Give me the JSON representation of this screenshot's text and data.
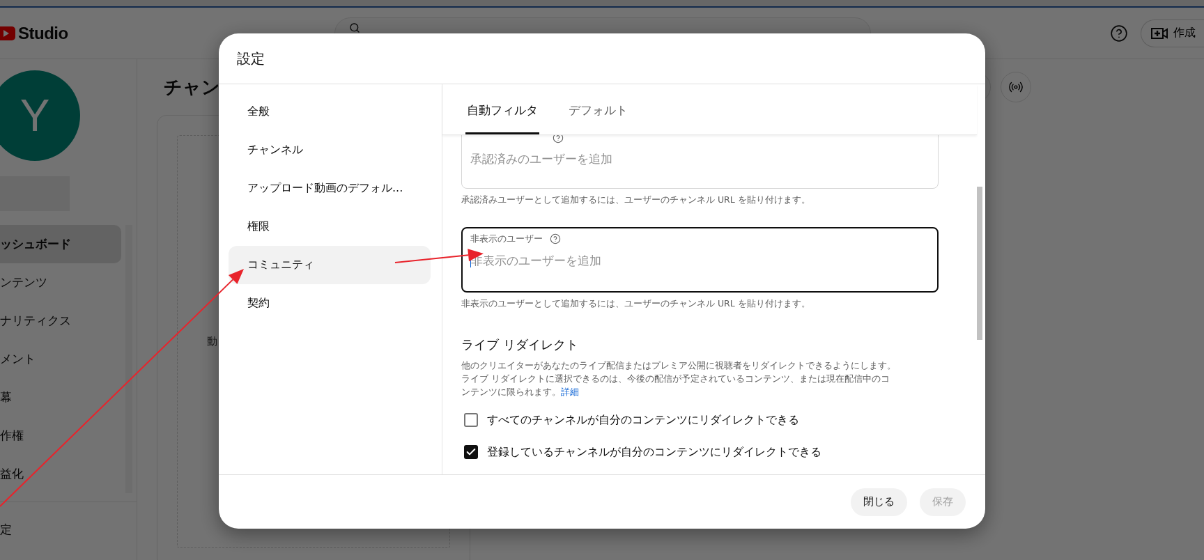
{
  "app": {
    "logo_text": "Studio",
    "create_label": "作成"
  },
  "sidebar": {
    "avatar_letter": "Y",
    "items": [
      {
        "label": "ッシュボード",
        "selected": true
      },
      {
        "label": "ンテンツ",
        "selected": false
      },
      {
        "label": "ナリティクス",
        "selected": false
      },
      {
        "label": "メント",
        "selected": false
      },
      {
        "label": "幕",
        "selected": false
      },
      {
        "label": "作権",
        "selected": false
      },
      {
        "label": "益化",
        "selected": false
      }
    ],
    "settings_label": "定"
  },
  "main": {
    "title": "チャン",
    "card_text": "動"
  },
  "dialog": {
    "title": "設定",
    "nav": [
      {
        "label": "全般",
        "selected": false
      },
      {
        "label": "チャンネル",
        "selected": false
      },
      {
        "label": "アップロード動画のデフォル...",
        "selected": false
      },
      {
        "label": "権限",
        "selected": false
      },
      {
        "label": "コミュニティ",
        "selected": true
      },
      {
        "label": "契約",
        "selected": false
      }
    ],
    "tabs": [
      {
        "label": "自動フィルタ",
        "selected": true
      },
      {
        "label": "デフォルト",
        "selected": false
      }
    ],
    "fields": [
      {
        "placeholder": "承認済みのユーザーを追加",
        "focused": false,
        "helper": "承認済みユーザーとして追加するには、ユーザーのチャンネル URL を貼り付けます。"
      },
      {
        "label": "非表示のユーザー",
        "placeholder": "非表示のユーザーを追加",
        "focused": true,
        "helper": "非表示のユーザーとして追加するには、ユーザーのチャンネル URL を貼り付けます。"
      }
    ],
    "section": {
      "heading": "ライブ リダイレクト",
      "description": "他のクリエイターがあなたのライブ配信またはプレミア公開に視聴者をリダイレクトできるようにします。ライブ リダイレクトに選択できるのは、今後の配信が予定されているコンテンツ、または現在配信中のコンテンツに限られます。",
      "link": "詳細"
    },
    "checkboxes": [
      {
        "label": "すべてのチャンネルが自分のコンテンツにリダイレクトできる",
        "checked": false
      },
      {
        "label": "登録しているチャンネルが自分のコンテンツにリダイレクトできる",
        "checked": true
      }
    ],
    "buttons": [
      {
        "label": "閉じる",
        "disabled": false
      },
      {
        "label": "保存",
        "disabled": true
      }
    ]
  }
}
